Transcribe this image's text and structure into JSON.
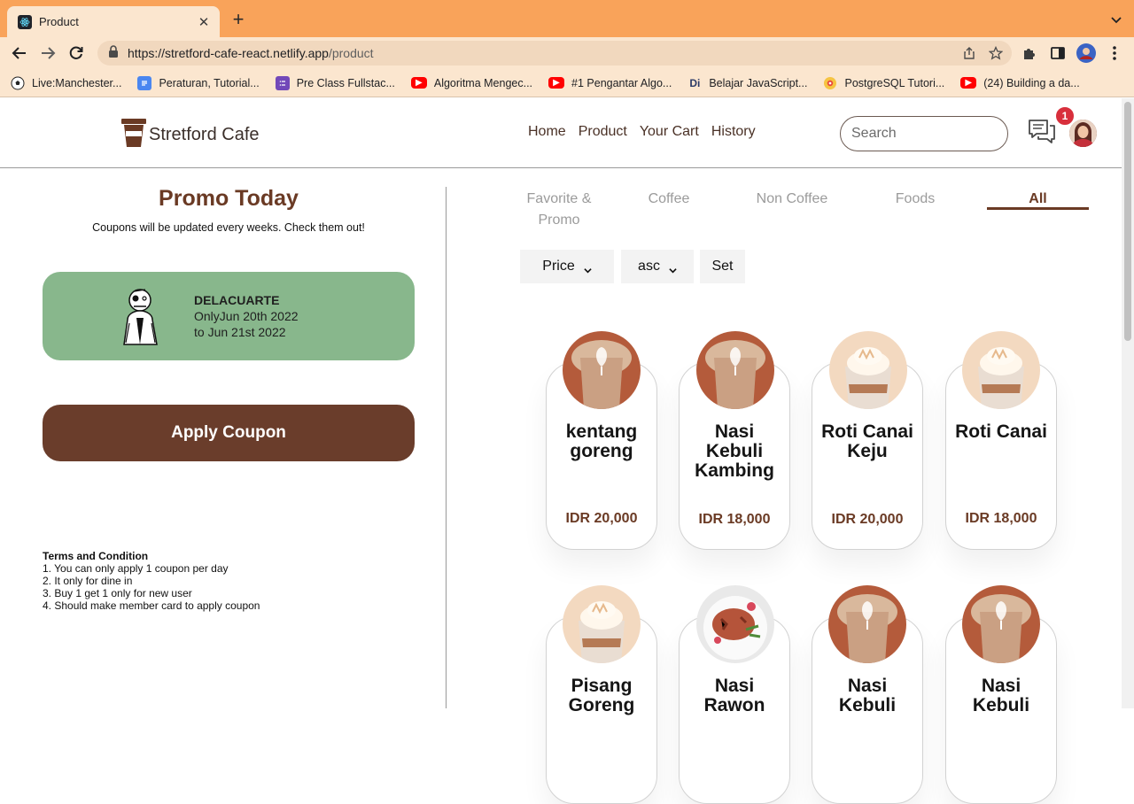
{
  "browser": {
    "tab_title": "Product",
    "url_host": "https://stretford-cafe-react.netlify.app",
    "url_path": "/product",
    "bookmarks": [
      {
        "label": "Live:Manchester...",
        "icon": "soccer-ball-icon"
      },
      {
        "label": "Peraturan, Tutorial...",
        "icon": "google-docs-icon"
      },
      {
        "label": "Pre Class Fullstac...",
        "icon": "google-forms-icon"
      },
      {
        "label": "Algoritma Mengec...",
        "icon": "youtube-icon"
      },
      {
        "label": "#1 Pengantar Algo...",
        "icon": "youtube-icon"
      },
      {
        "label": "Belajar JavaScript...",
        "icon": "dicoding-icon"
      },
      {
        "label": "PostgreSQL Tutori...",
        "icon": "postgresql-icon"
      },
      {
        "label": "(24) Building a da...",
        "icon": "youtube-icon"
      }
    ]
  },
  "header": {
    "brand": "Stretford Cafe",
    "nav": [
      "Home",
      "Product",
      "Your Cart",
      "History"
    ],
    "search_placeholder": "Search",
    "notification_count": "1"
  },
  "promo": {
    "title": "Promo Today",
    "subtitle": "Coupons will be updated every weeks. Check them out!",
    "coupon": {
      "code": "DELACUARTE",
      "line1": "OnlyJun 20th 2022",
      "line2": "to Jun 21st 2022",
      "color": "#88b78c"
    },
    "apply_label": "Apply Coupon",
    "terms_title": "Terms and Condition",
    "terms": [
      "1. You can only apply 1 coupon per day",
      "2. It only for dine in",
      "3. Buy 1 get 1 only for new user",
      "4. Should make member card to apply coupon"
    ]
  },
  "products": {
    "categories": [
      "Favorite &",
      "Promo",
      "Coffee",
      "Non Coffee",
      "Foods",
      "All"
    ],
    "active_category": "All",
    "sort_field": "Price",
    "sort_order": "asc",
    "set_label": "Set",
    "items": [
      {
        "name": "kentang goreng",
        "price": "IDR 20,000",
        "image": "latte-art"
      },
      {
        "name": "Nasi Kebuli Kambing",
        "price": "IDR 18,000",
        "image": "latte-art"
      },
      {
        "name": "Roti Canai Keju",
        "price": "IDR 20,000",
        "image": "cream-frappe"
      },
      {
        "name": "Roti Canai",
        "price": "IDR 18,000",
        "image": "cream-frappe"
      },
      {
        "name": "Pisang Goreng",
        "price": "",
        "image": "cream-frappe"
      },
      {
        "name": "Nasi Rawon",
        "price": "",
        "image": "food-plate"
      },
      {
        "name": "Nasi Kebuli",
        "price": "",
        "image": "latte-art"
      },
      {
        "name": "Nasi Kebuli",
        "price": "",
        "image": "latte-art"
      }
    ]
  },
  "colors": {
    "brand_brown": "#6a3a24",
    "button_brown": "#6a3d2b",
    "coupon_green": "#88b78c",
    "badge_red": "#d82f3c",
    "tabbar_orange": "#f9a35a"
  }
}
